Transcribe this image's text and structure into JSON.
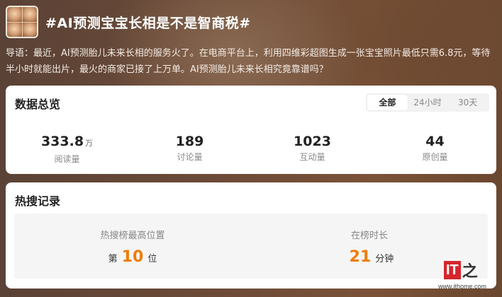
{
  "topic": {
    "title": "#AI预测宝宝长相是不是智商税#"
  },
  "intro": "导语：最近，AI预测胎儿未来长相的服务火了。在电商平台上，利用四维彩超图生成一张宝宝照片最低只需6.8元，等待半小时就能出片，最火的商家已接了上万单。AI预测胎儿未来长相究竟靠谱吗？",
  "overview": {
    "title": "数据总览",
    "tabs": [
      "全部",
      "24小时",
      "30天"
    ],
    "active_tab": "全部",
    "stats": [
      {
        "value": "333.8",
        "unit": "万",
        "label": "阅读量"
      },
      {
        "value": "189",
        "unit": "",
        "label": "讨论量"
      },
      {
        "value": "1023",
        "unit": "",
        "label": "互动量"
      },
      {
        "value": "44",
        "unit": "",
        "label": "原创量"
      }
    ]
  },
  "hot": {
    "title": "热搜记录",
    "highest": {
      "label": "热搜榜最高位置",
      "prefix": "第",
      "value": "10",
      "suffix": "位"
    },
    "duration": {
      "label": "在榜时长",
      "value": "21",
      "suffix": "分钟"
    }
  },
  "watermark": {
    "logo_text": "IT",
    "logo_char": "之",
    "url": "www.ithome.com"
  }
}
